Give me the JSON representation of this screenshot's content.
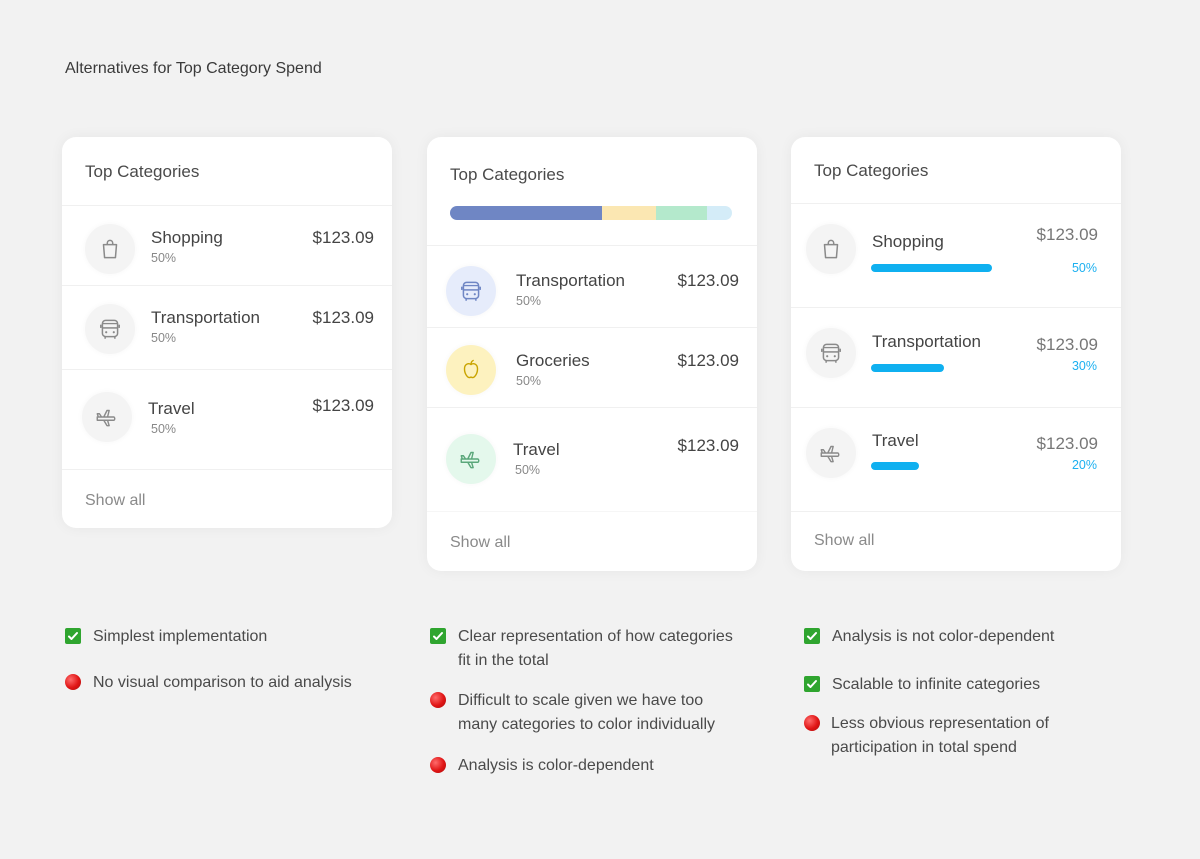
{
  "page": {
    "title": "Alternatives for Top Category Spend"
  },
  "colors": {
    "accent_blue": "#0fb0f0",
    "stack_transportation": "#6f86c4",
    "stack_groceries": "#fbe7b2",
    "stack_travel": "#b4e9cc",
    "stack_rest": "#d4ecf8",
    "icon_transportation_bg": "#e6ecfb",
    "icon_groceries_bg": "#fdf2bf",
    "icon_travel_bg": "#e4f8ec",
    "check_green": "#2fa52f",
    "dot_red": "#e01515"
  },
  "card1": {
    "title": "Top Categories",
    "rows": [
      {
        "name": "Shopping",
        "pct": "50%",
        "amount": "$123.09",
        "icon": "shopping-bag-icon"
      },
      {
        "name": "Transportation",
        "pct": "50%",
        "amount": "$123.09",
        "icon": "bus-icon"
      },
      {
        "name": "Travel",
        "pct": "50%",
        "amount": "$123.09",
        "icon": "airplane-icon"
      }
    ],
    "show_all": "Show all"
  },
  "card2": {
    "title": "Top Categories",
    "stack_segments": [
      {
        "category": "Transportation",
        "share": 0.54
      },
      {
        "category": "Groceries",
        "share": 0.19
      },
      {
        "category": "Travel",
        "share": 0.18
      },
      {
        "category": "Other",
        "share": 0.09
      }
    ],
    "rows": [
      {
        "name": "Transportation",
        "pct": "50%",
        "amount": "$123.09",
        "icon": "bus-icon"
      },
      {
        "name": "Groceries",
        "pct": "50%",
        "amount": "$123.09",
        "icon": "apple-icon"
      },
      {
        "name": "Travel",
        "pct": "50%",
        "amount": "$123.09",
        "icon": "airplane-icon"
      }
    ],
    "show_all": "Show all"
  },
  "card3": {
    "title": "Top Categories",
    "rows": [
      {
        "name": "Shopping",
        "pct": "50%",
        "amount": "$123.09",
        "icon": "shopping-bag-icon",
        "share": 0.5
      },
      {
        "name": "Transportation",
        "pct": "30%",
        "amount": "$123.09",
        "icon": "bus-icon",
        "share": 0.3
      },
      {
        "name": "Travel",
        "pct": "20%",
        "amount": "$123.09",
        "icon": "airplane-icon",
        "share": 0.2
      }
    ],
    "show_all": "Show all"
  },
  "notes": {
    "col1": [
      {
        "type": "pro",
        "text": "Simplest implementation"
      },
      {
        "type": "con",
        "text": "No visual comparison to aid analysis"
      }
    ],
    "col2": [
      {
        "type": "pro",
        "line1": "Clear representation of how categories",
        "line2": "fit in the total"
      },
      {
        "type": "con",
        "line1": "Difficult to scale given we have too",
        "line2": "many categories to color individually"
      },
      {
        "type": "con",
        "text": "Analysis is color-dependent"
      }
    ],
    "col3": [
      {
        "type": "pro",
        "text": "Analysis is not color-dependent"
      },
      {
        "type": "pro",
        "text": "Scalable to infinite categories"
      },
      {
        "type": "con",
        "line1": "Less obvious representation of",
        "line2": "participation in total spend"
      }
    ]
  }
}
